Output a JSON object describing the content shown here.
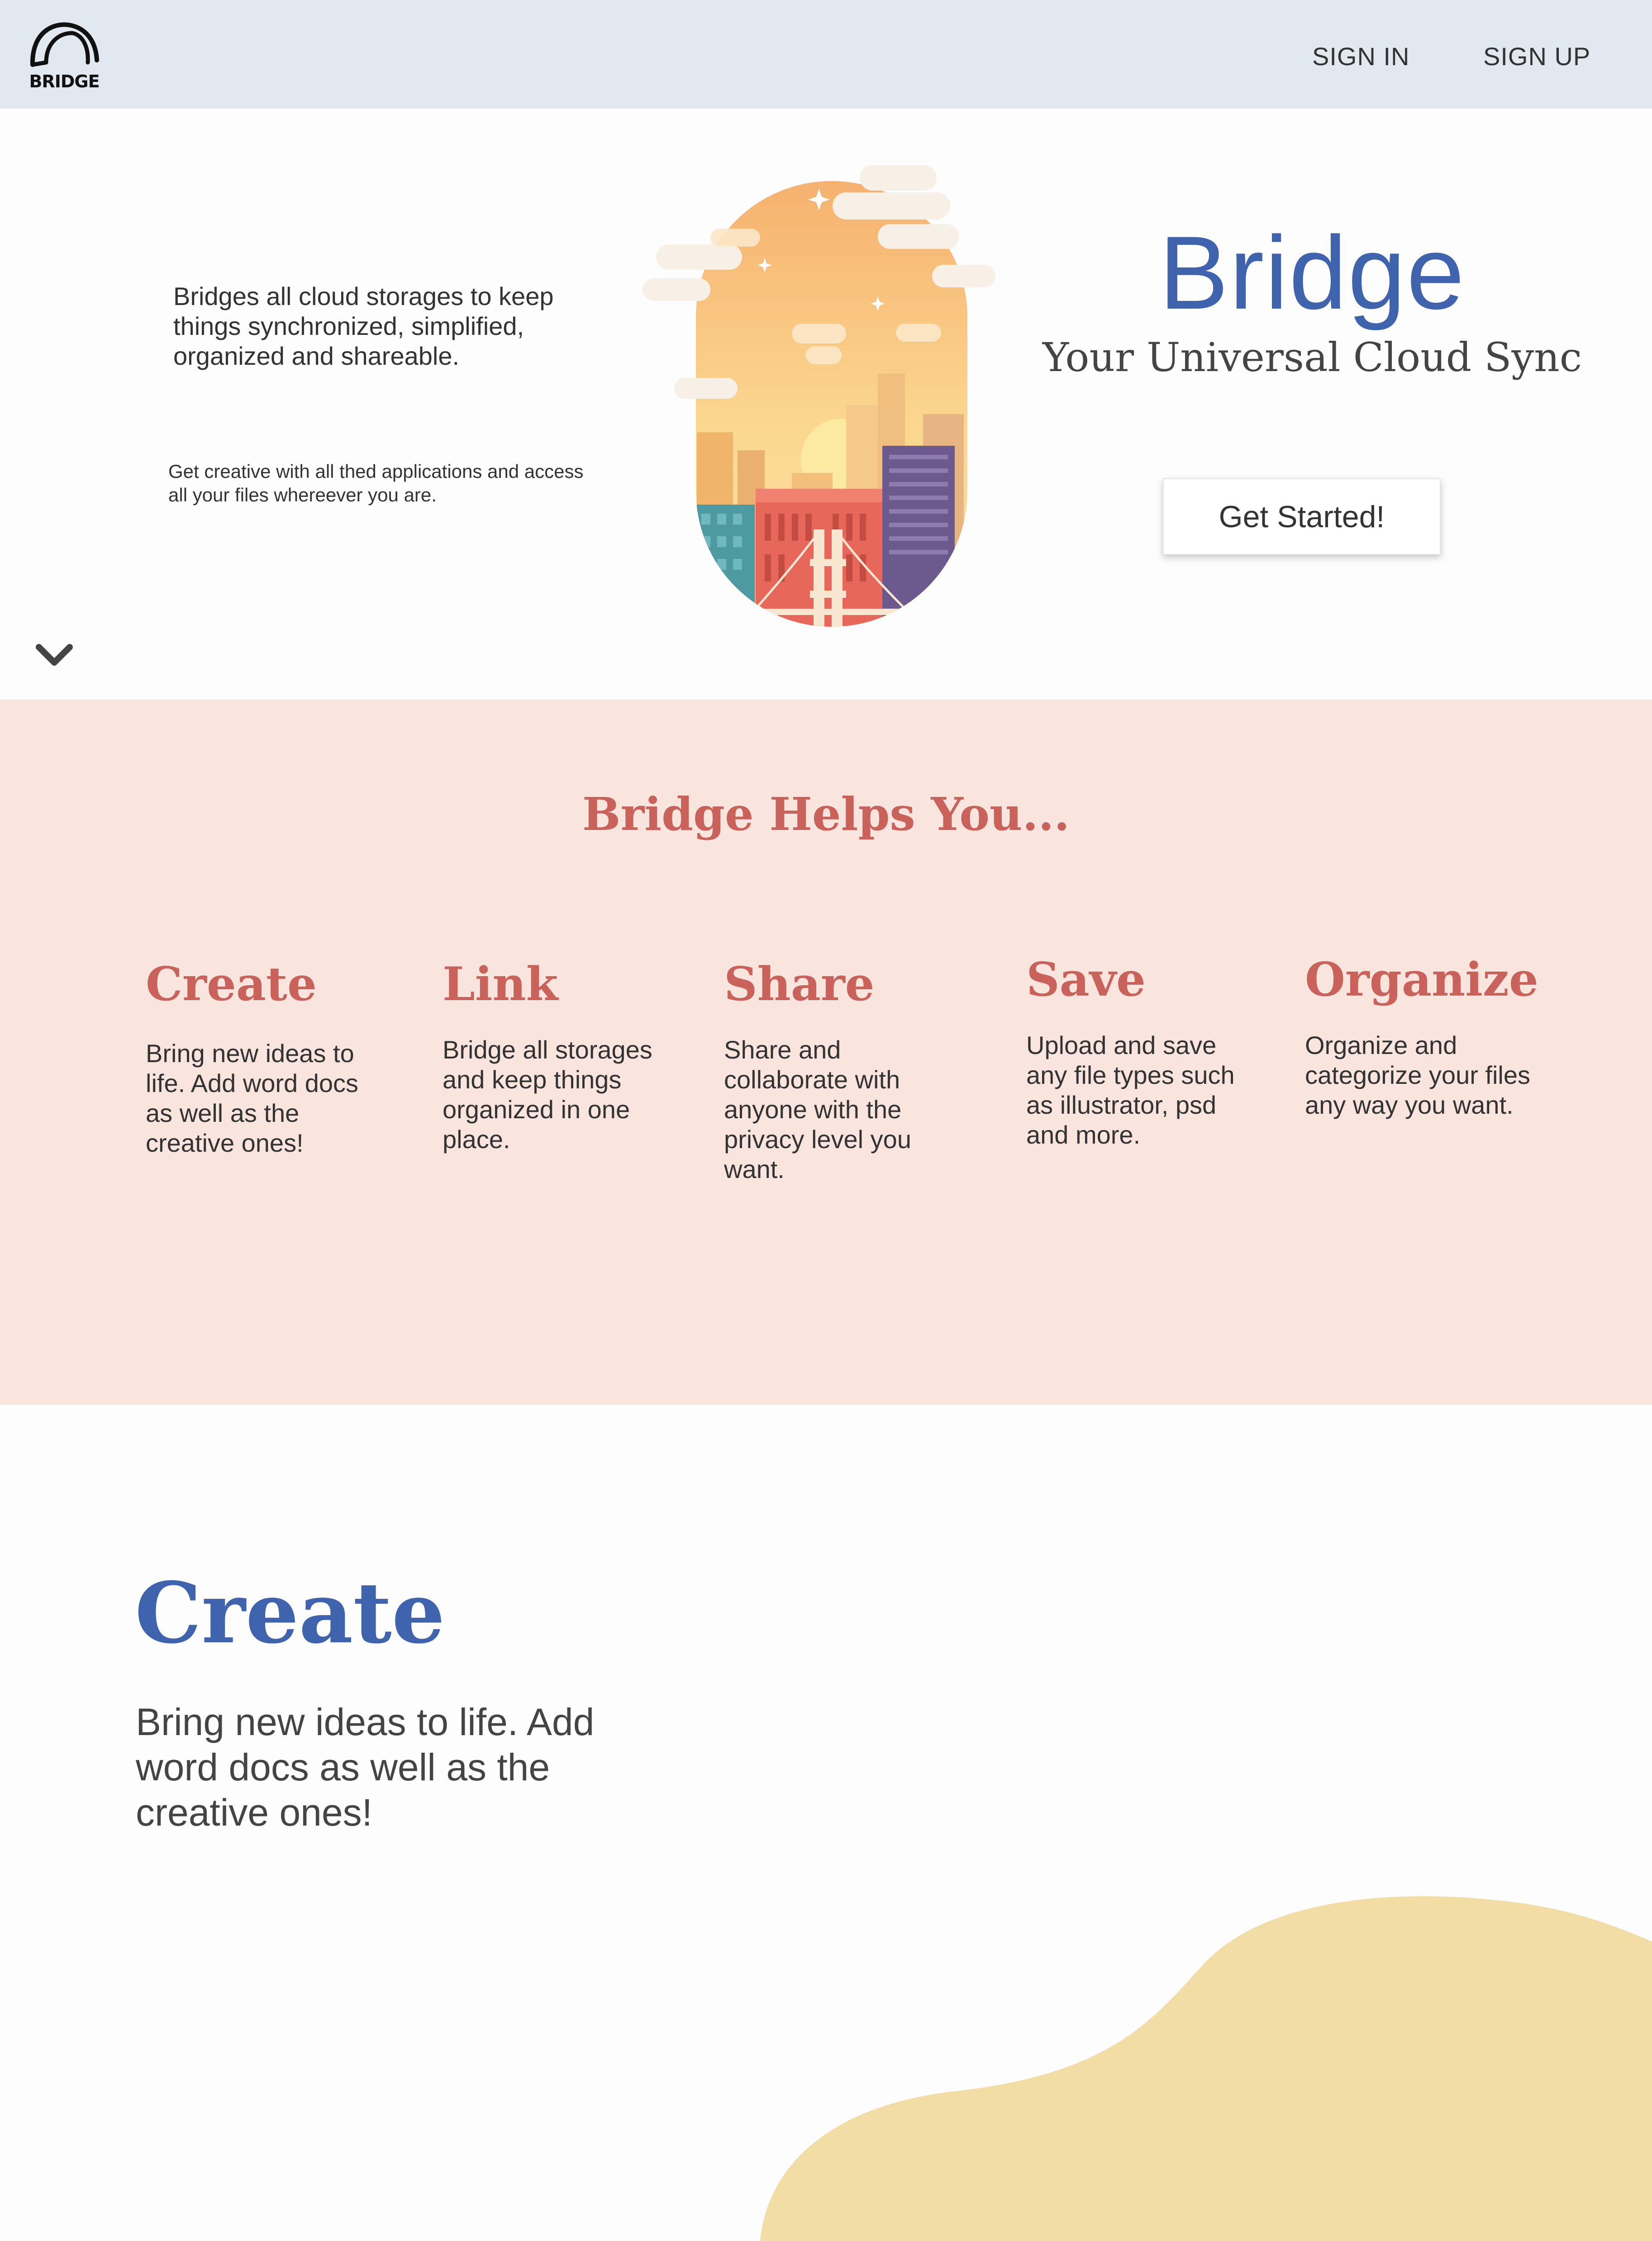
{
  "header": {
    "logo_text": "BRIDGE",
    "nav": {
      "sign_in": "SIGN IN",
      "sign_up": "SIGN UP"
    }
  },
  "hero": {
    "description": "Bridges all cloud storages to keep things synchronized, simplified, organized and shareable.",
    "sub_description": "Get creative with all thed applications and access all your files whereever you are.",
    "brand_title": "Bridge",
    "tagline": "Your Universal Cloud Sync",
    "cta_label": "Get Started!",
    "scroll_icon": "chevron-down-icon"
  },
  "features": {
    "title": "Bridge Helps You...",
    "items": [
      {
        "title": "Create",
        "text": "Bring new ideas to life. Add word docs as well as the creative ones!"
      },
      {
        "title": "Link",
        "text": "Bridge all storages and keep things organized in one place."
      },
      {
        "title": "Share",
        "text": "Share and collaborate with anyone with the privacy level you want."
      },
      {
        "title": "Save",
        "text": "Upload and save any file types such as illustrator, psd and more."
      },
      {
        "title": "Organize",
        "text": "Organize and categorize your files any way you want."
      }
    ]
  },
  "detail": {
    "title": "Create",
    "text": "Bring new ideas to life. Add word docs as well as the creative ones!"
  },
  "colors": {
    "header_bg": "#e1e8f0",
    "brand_blue": "#3f64ad",
    "accent_red": "#c8625a",
    "features_bg": "#f9e4de",
    "blob_yellow": "#f2dea5"
  }
}
